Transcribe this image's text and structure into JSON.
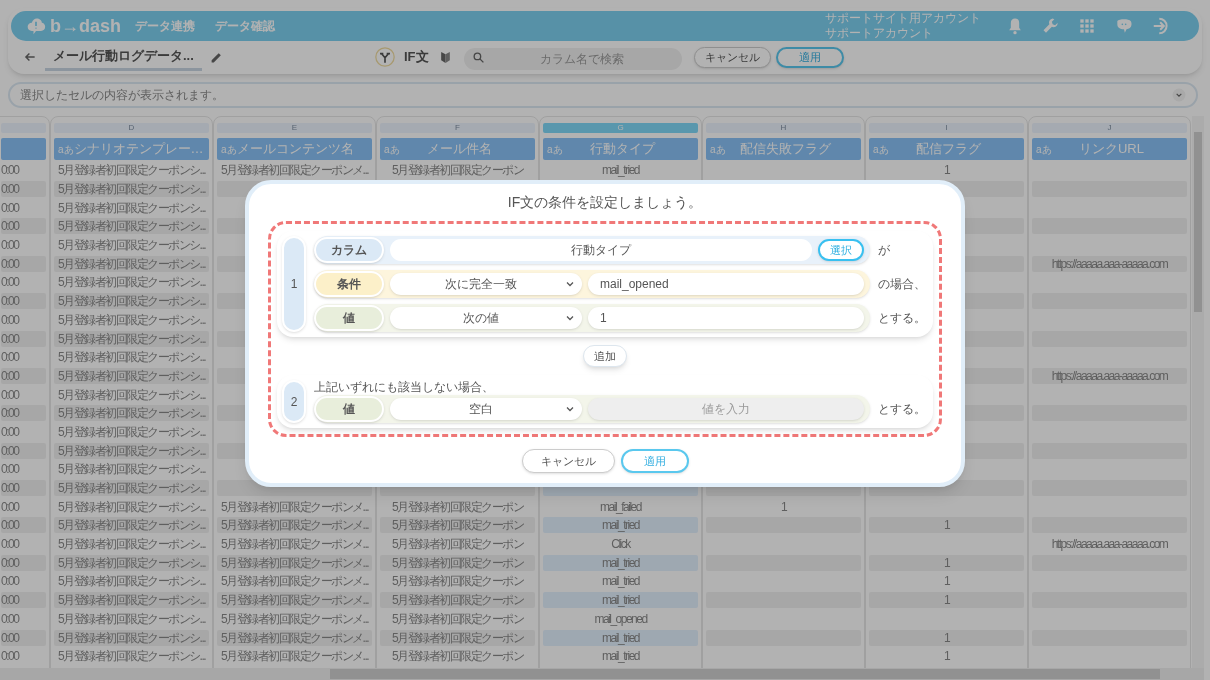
{
  "app_header": {
    "logo": "b→dash",
    "nav": [
      {
        "label": "データ連携"
      },
      {
        "label": "データ確認"
      }
    ],
    "account": {
      "line_1": "サポートサイト用アカウント",
      "line_2": "サポートアカウント"
    }
  },
  "toolbar": {
    "title": "メール行動ログデータ...",
    "mode_label": "IF文",
    "search": {
      "placeholder": "カラム名で検索"
    },
    "buttons": [
      {
        "label": "キャンセル",
        "kind": "secondary"
      },
      {
        "label": "適用",
        "kind": "primary"
      }
    ]
  },
  "cell_viewer": {
    "placeholder": "選択したセルの内容が表示されます。"
  },
  "table": {
    "columns": [
      {
        "selected": false
      },
      {
        "letter": "D",
        "type_label": "aあ",
        "name": "シナリオテンプレー…",
        "selected": false
      },
      {
        "letter": "E",
        "type_label": "aあ",
        "name": "メールコンテンツ名",
        "selected": false
      },
      {
        "letter": "F",
        "type_label": "aあ",
        "name": "メール件名",
        "selected": false
      },
      {
        "letter": "G",
        "type_label": "aあ",
        "name": "行動タイプ",
        "selected": true
      },
      {
        "letter": "H",
        "type_label": "aあ",
        "name": "配信失敗フラグ",
        "selected": false
      },
      {
        "letter": "I",
        "type_label": "aあ",
        "name": "配信フラグ",
        "selected": false
      },
      {
        "letter": "J",
        "type_label": "aあ",
        "name": "リンクURL",
        "selected": false
      }
    ],
    "rows": [
      {
        "cells": [
          "0:00",
          "5月登録者初回限定クーポンシ...",
          "5月登録者初回限定クーポンメ...",
          "5月登録者初回限定クーポン",
          "mail_tried",
          null,
          "1",
          null
        ]
      },
      {
        "cells": [
          "0:00",
          "5月登録者初回限定クーポンシ...",
          null,
          null,
          null,
          null,
          null,
          null
        ]
      },
      {
        "cells": [
          "0:00",
          "5月登録者初回限定クーポンシ...",
          null,
          null,
          null,
          null,
          null,
          null
        ]
      },
      {
        "cells": [
          "0:00",
          "5月登録者初回限定クーポンシ...",
          null,
          null,
          null,
          null,
          null,
          null
        ]
      },
      {
        "cells": [
          "0:00",
          "5月登録者初回限定クーポンシ...",
          null,
          null,
          null,
          null,
          null,
          null
        ]
      },
      {
        "cells": [
          "0:00",
          "5月登録者初回限定クーポンシ...",
          null,
          null,
          null,
          null,
          null,
          "https://aaaaa.aaa-aaaaa.com"
        ]
      },
      {
        "cells": [
          "0:00",
          "5月登録者初回限定クーポンシ...",
          null,
          null,
          null,
          null,
          null,
          null
        ]
      },
      {
        "cells": [
          "0:00",
          "5月登録者初回限定クーポンシ...",
          null,
          null,
          null,
          null,
          null,
          null
        ]
      },
      {
        "cells": [
          "0:00",
          "5月登録者初回限定クーポンシ...",
          null,
          null,
          null,
          null,
          null,
          null
        ]
      },
      {
        "cells": [
          "0:00",
          "5月登録者初回限定クーポンシ...",
          null,
          null,
          null,
          null,
          null,
          null
        ]
      },
      {
        "cells": [
          "0:00",
          "5月登録者初回限定クーポンシ...",
          null,
          null,
          null,
          null,
          null,
          null
        ]
      },
      {
        "cells": [
          "0:00",
          "5月登録者初回限定クーポンシ...",
          null,
          null,
          null,
          null,
          null,
          "https://aaaaa.aaa-aaaaa.com"
        ]
      },
      {
        "cells": [
          "0:00",
          "5月登録者初回限定クーポンシ...",
          null,
          null,
          null,
          null,
          null,
          null
        ]
      },
      {
        "cells": [
          "0:00",
          "5月登録者初回限定クーポンシ...",
          null,
          null,
          null,
          null,
          null,
          null
        ]
      },
      {
        "cells": [
          "0:00",
          "5月登録者初回限定クーポンシ...",
          null,
          null,
          null,
          null,
          null,
          null
        ]
      },
      {
        "cells": [
          "0:00",
          "5月登録者初回限定クーポンシ...",
          null,
          null,
          null,
          null,
          null,
          null
        ]
      },
      {
        "cells": [
          "0:00",
          "5月登録者初回限定クーポンシ...",
          null,
          null,
          null,
          null,
          null,
          null
        ]
      },
      {
        "cells": [
          "0:00",
          "5月登録者初回限定クーポンシ...",
          null,
          null,
          null,
          null,
          null,
          null
        ]
      },
      {
        "cells": [
          "0:00",
          "5月登録者初回限定クーポンシ...",
          "5月登録者初回限定クーポンメ...",
          "5月登録者初回限定クーポン",
          "mail_failed",
          "1",
          null,
          null
        ]
      },
      {
        "cells": [
          "0:00",
          "5月登録者初回限定クーポンシ...",
          "5月登録者初回限定クーポンメ...",
          "5月登録者初回限定クーポン",
          "mail_tried",
          null,
          "1",
          null
        ]
      },
      {
        "cells": [
          "0:00",
          "5月登録者初回限定クーポンシ...",
          "5月登録者初回限定クーポンメ...",
          "5月登録者初回限定クーポン",
          "Click",
          null,
          null,
          "https://aaaaa.aaa-aaaaa.com"
        ]
      },
      {
        "cells": [
          "0:00",
          "5月登録者初回限定クーポンシ...",
          "5月登録者初回限定クーポンメ...",
          "5月登録者初回限定クーポン",
          "mail_tried",
          null,
          "1",
          null
        ]
      },
      {
        "cells": [
          "0:00",
          "5月登録者初回限定クーポンシ...",
          "5月登録者初回限定クーポンメ...",
          "5月登録者初回限定クーポン",
          "mail_tried",
          null,
          "1",
          null
        ]
      },
      {
        "cells": [
          "0:00",
          "5月登録者初回限定クーポンシ...",
          "5月登録者初回限定クーポンメ...",
          "5月登録者初回限定クーポン",
          "mail_tried",
          null,
          "1",
          null
        ]
      },
      {
        "cells": [
          "0:00",
          "5月登録者初回限定クーポンシ...",
          "5月登録者初回限定クーポンメ...",
          "5月登録者初回限定クーポン",
          "mail_opened",
          null,
          null,
          null
        ]
      },
      {
        "cells": [
          "0:00",
          "5月登録者初回限定クーポンシ...",
          "5月登録者初回限定クーポンメ...",
          "5月登録者初回限定クーポン",
          "mail_tried",
          null,
          "1",
          null
        ]
      },
      {
        "cells": [
          "0:00",
          "5月登録者初回限定クーポンシ...",
          "5月登録者初回限定クーポンメ...",
          "5月登録者初回限定クーポン",
          "mail_tried",
          null,
          "1",
          null
        ]
      }
    ]
  },
  "dialog": {
    "title": "IF文の条件を設定しましょう。",
    "conditions": [
      {
        "number": "1",
        "rows": [
          {
            "kind": "column",
            "label": "カラム",
            "value": "行動タイプ",
            "button": "選択",
            "suffix": "が"
          },
          {
            "kind": "condition",
            "label": "条件",
            "operator": "次に完全一致",
            "value": "mail_opened",
            "suffix": "の場合、"
          },
          {
            "kind": "value",
            "label": "値",
            "operator": "次の値",
            "value": "1",
            "suffix": "とする。"
          }
        ]
      }
    ],
    "add_button": "追加",
    "fallback": {
      "number": "2",
      "caption": "上記いずれにも該当しない場合、",
      "row": {
        "kind": "value",
        "label": "値",
        "operator": "空白",
        "placeholder": "値を入力",
        "disabled": true,
        "suffix": "とする。"
      }
    },
    "buttons": [
      {
        "label": "キャンセル",
        "kind": "secondary"
      },
      {
        "label": "適用",
        "kind": "primary"
      }
    ]
  }
}
